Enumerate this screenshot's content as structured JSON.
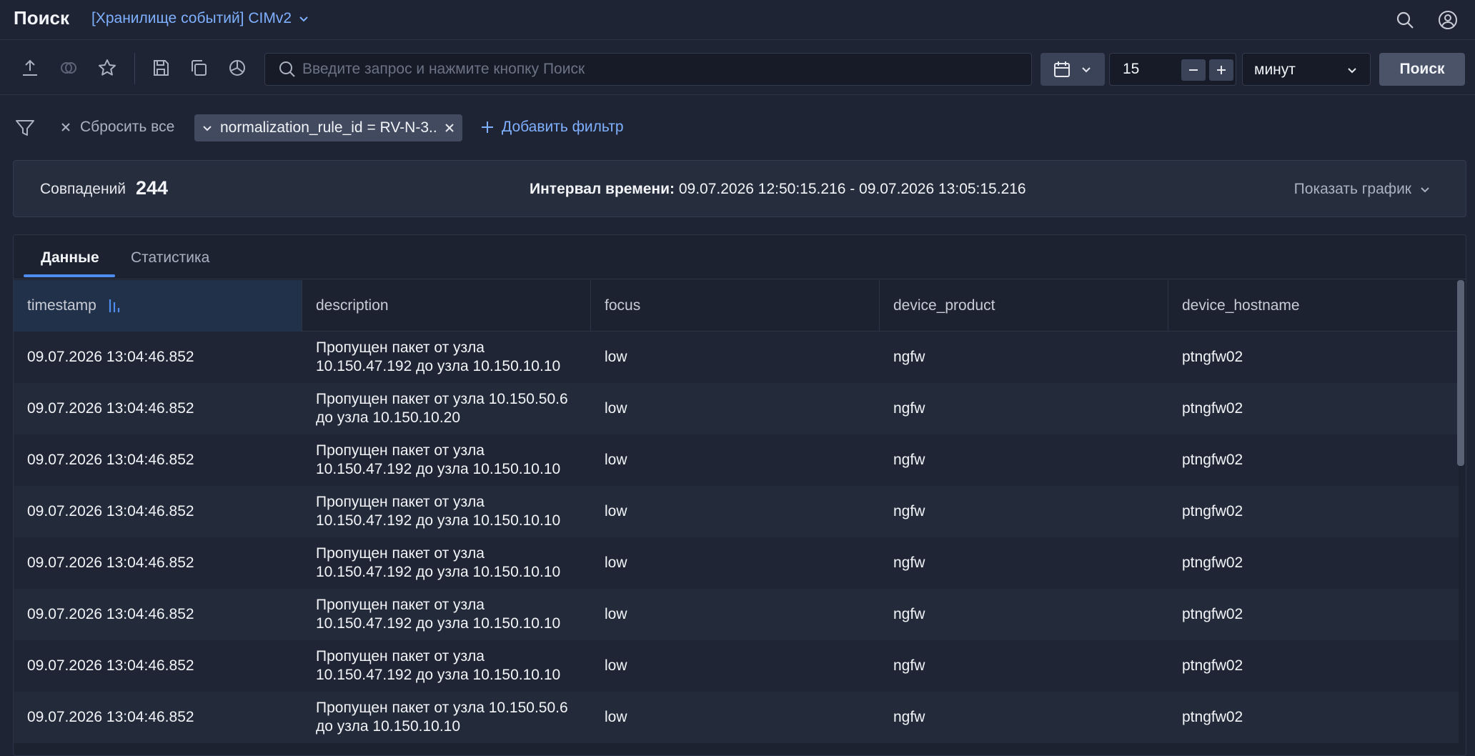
{
  "header": {
    "title": "Поиск",
    "storage": "[Хранилище событий] CIMv2"
  },
  "toolbar": {
    "search_placeholder": "Введите запрос и нажмите кнопку Поиск",
    "period_value": "15",
    "period_unit": "минут",
    "search_button": "Поиск"
  },
  "filters": {
    "reset_all": "Сбросить все",
    "chip": "normalization_rule_id = RV-N-3...",
    "add_filter": "Добавить фильтр"
  },
  "summary": {
    "matches_label": "Совпадений",
    "matches_count": "244",
    "interval_label": "Интервал времени:",
    "interval_value": "09.07.2026 12:50:15.216 - 09.07.2026 13:05:15.216",
    "show_graph": "Показать график"
  },
  "tabs": [
    {
      "label": "Данные",
      "active": true
    },
    {
      "label": "Статистика",
      "active": false
    }
  ],
  "table": {
    "columns": [
      "timestamp",
      "description",
      "focus",
      "device_product",
      "device_hostname"
    ],
    "rows": [
      {
        "timestamp": "09.07.2026 13:04:46.852",
        "desc1": "Пропущен пакет от узла",
        "desc2": "10.150.47.192 до узла 10.150.10.10",
        "focus": "low",
        "device_product": "ngfw",
        "device_hostname": "ptngfw02"
      },
      {
        "timestamp": "09.07.2026 13:04:46.852",
        "desc1": "Пропущен пакет от узла 10.150.50.6",
        "desc2": "до узла 10.150.10.20",
        "focus": "low",
        "device_product": "ngfw",
        "device_hostname": "ptngfw02"
      },
      {
        "timestamp": "09.07.2026 13:04:46.852",
        "desc1": "Пропущен пакет от узла",
        "desc2": "10.150.47.192 до узла 10.150.10.10",
        "focus": "low",
        "device_product": "ngfw",
        "device_hostname": "ptngfw02"
      },
      {
        "timestamp": "09.07.2026 13:04:46.852",
        "desc1": "Пропущен пакет от узла",
        "desc2": "10.150.47.192 до узла 10.150.10.10",
        "focus": "low",
        "device_product": "ngfw",
        "device_hostname": "ptngfw02"
      },
      {
        "timestamp": "09.07.2026 13:04:46.852",
        "desc1": "Пропущен пакет от узла",
        "desc2": "10.150.47.192 до узла 10.150.10.10",
        "focus": "low",
        "device_product": "ngfw",
        "device_hostname": "ptngfw02"
      },
      {
        "timestamp": "09.07.2026 13:04:46.852",
        "desc1": "Пропущен пакет от узла",
        "desc2": "10.150.47.192 до узла 10.150.10.10",
        "focus": "low",
        "device_product": "ngfw",
        "device_hostname": "ptngfw02"
      },
      {
        "timestamp": "09.07.2026 13:04:46.852",
        "desc1": "Пропущен пакет от узла",
        "desc2": "10.150.47.192 до узла 10.150.10.10",
        "focus": "low",
        "device_product": "ngfw",
        "device_hostname": "ptngfw02"
      },
      {
        "timestamp": "09.07.2026 13:04:46.852",
        "desc1": "Пропущен пакет от узла 10.150.50.6",
        "desc2": "до узла 10.150.10.10",
        "focus": "low",
        "device_product": "ngfw",
        "device_hostname": "ptngfw02"
      }
    ]
  },
  "colors": {
    "background": "#1e2433",
    "accent": "#4f8cf0",
    "link": "#7fb0ff"
  }
}
